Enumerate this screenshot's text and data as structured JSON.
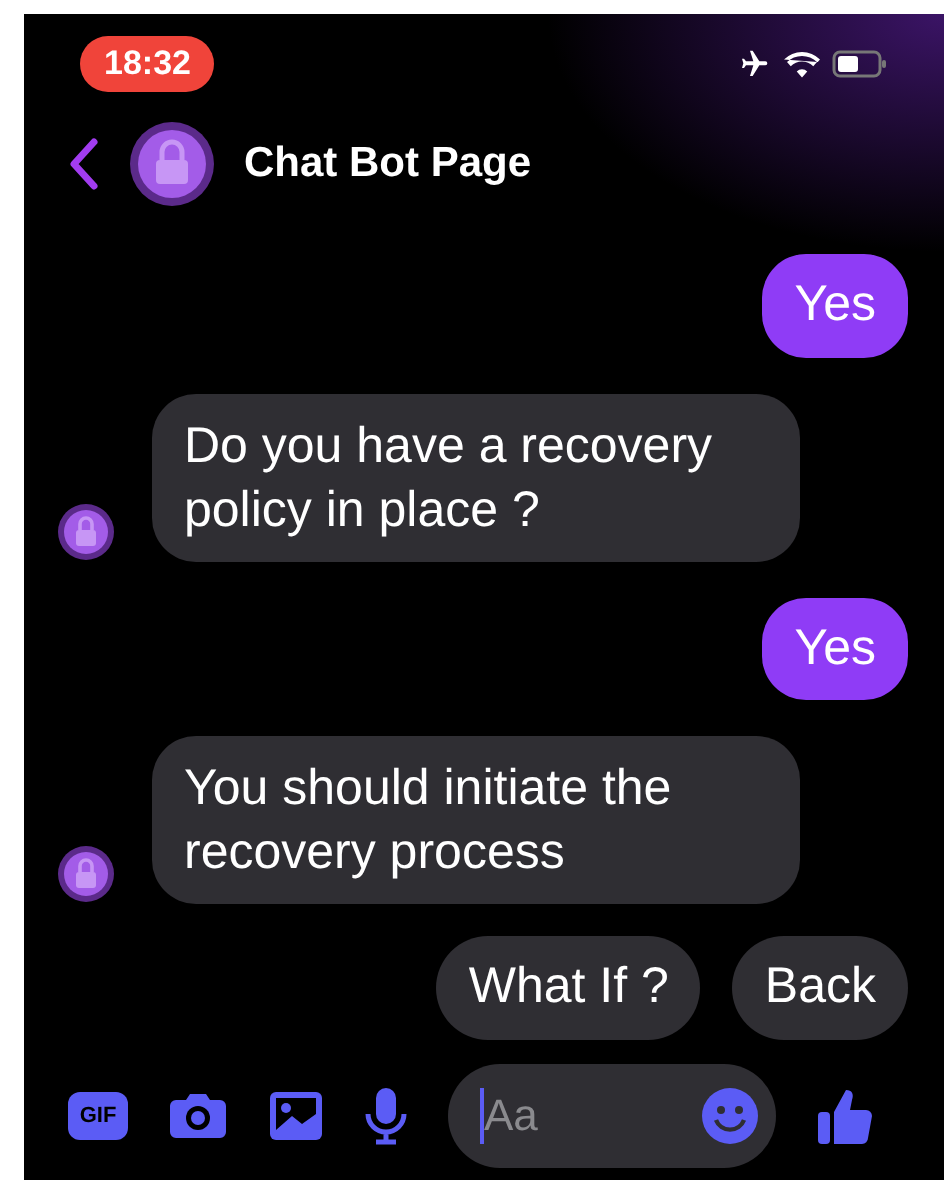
{
  "status_bar": {
    "time": "18:32"
  },
  "header": {
    "title": "Chat Bot Page"
  },
  "messages": [
    {
      "kind": "sent",
      "text": "Yes"
    },
    {
      "kind": "received",
      "text": "Do you have a recovery policy in place ?"
    },
    {
      "kind": "sent",
      "text": "Yes"
    },
    {
      "kind": "received",
      "text": "You should initiate the recovery process"
    }
  ],
  "quick_replies": [
    "What If ?",
    "Back"
  ],
  "composer": {
    "gif_label": "GIF",
    "placeholder": "Aa"
  }
}
